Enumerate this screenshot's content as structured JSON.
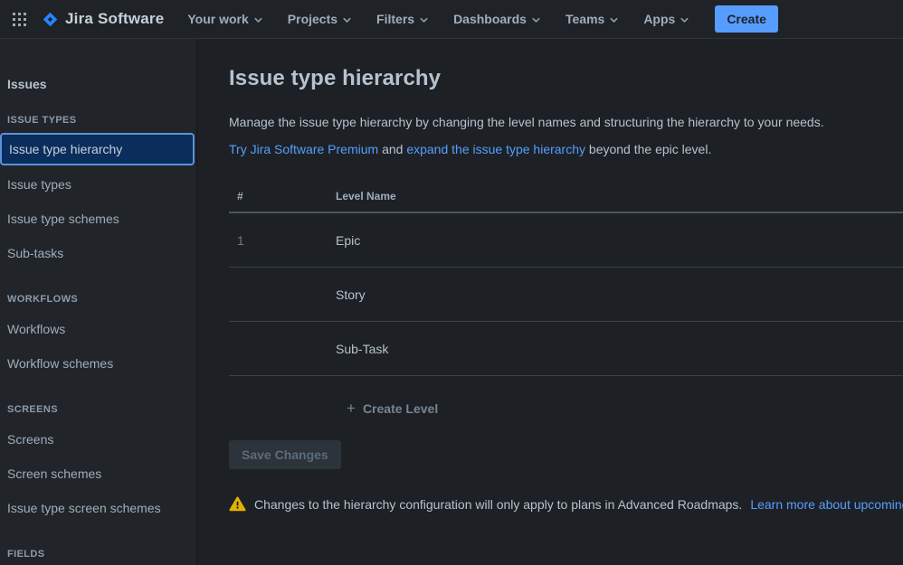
{
  "brand": {
    "app_name": "Jira Software"
  },
  "nav": {
    "items": [
      {
        "label": "Your work"
      },
      {
        "label": "Projects"
      },
      {
        "label": "Filters"
      },
      {
        "label": "Dashboards"
      },
      {
        "label": "Teams"
      },
      {
        "label": "Apps"
      }
    ],
    "create_label": "Create"
  },
  "sidebar": {
    "title": "Issues",
    "sections": [
      {
        "header": "ISSUE TYPES",
        "items": [
          {
            "label": "Issue type hierarchy",
            "selected": true
          },
          {
            "label": "Issue types",
            "selected": false
          },
          {
            "label": "Issue type schemes",
            "selected": false
          },
          {
            "label": "Sub-tasks",
            "selected": false
          }
        ]
      },
      {
        "header": "WORKFLOWS",
        "items": [
          {
            "label": "Workflows",
            "selected": false
          },
          {
            "label": "Workflow schemes",
            "selected": false
          }
        ]
      },
      {
        "header": "SCREENS",
        "items": [
          {
            "label": "Screens",
            "selected": false
          },
          {
            "label": "Screen schemes",
            "selected": false
          },
          {
            "label": "Issue type screen schemes",
            "selected": false
          }
        ]
      },
      {
        "header": "FIELDS",
        "items": []
      }
    ]
  },
  "main": {
    "title": "Issue type hierarchy",
    "description": "Manage the issue type hierarchy by changing the level names and structuring the hierarchy to your needs.",
    "premium_line": {
      "link1": "Try Jira Software Premium",
      "middle": " and ",
      "link2": "expand the issue type hierarchy",
      "end": " beyond the epic level."
    },
    "table": {
      "columns": [
        "#",
        "Level Name"
      ],
      "rows": [
        {
          "number": "1",
          "level_name": "Epic"
        },
        {
          "number": "",
          "level_name": "Story"
        },
        {
          "number": "",
          "level_name": "Sub-Task"
        }
      ]
    },
    "create_level_label": "Create Level",
    "save_button_label": "Save Changes",
    "warning": {
      "text": "Changes to the hierarchy configuration will only apply to plans in Advanced Roadmaps. ",
      "link": "Learn more about upcoming updates"
    }
  },
  "colors": {
    "accent": "#579DFF",
    "link": "#579DFF",
    "warning_icon": "#E2B203",
    "selected_bg": "#0A2D5C",
    "selected_border": "#5C92DB"
  }
}
